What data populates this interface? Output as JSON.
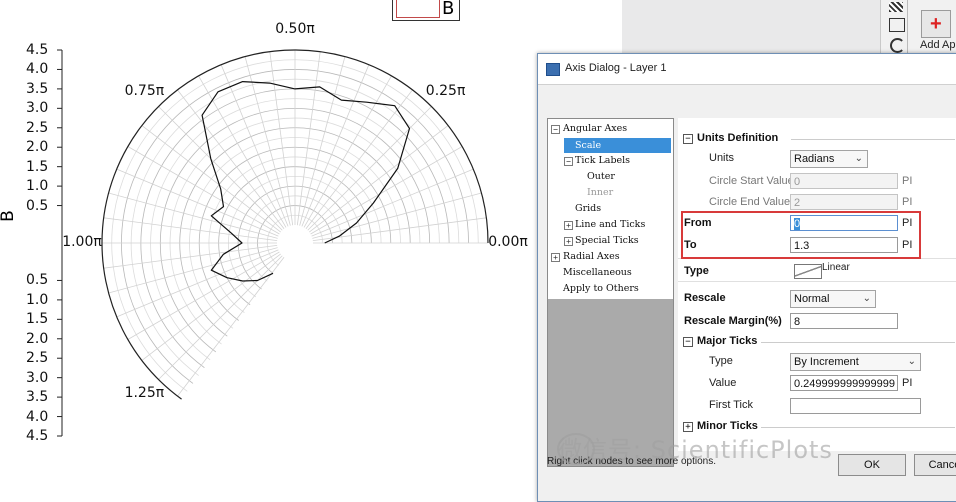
{
  "chart_data": {
    "type": "polar-line",
    "legend": [
      "B"
    ],
    "yaxis_label": "B",
    "radial_range": [
      0,
      4.5
    ],
    "radial_ticks": [
      "4.5",
      "4.0",
      "3.5",
      "3.0",
      "2.5",
      "2.0",
      "1.5",
      "1.0",
      "0.5",
      "0.5",
      "1.0",
      "1.5",
      "2.0",
      "2.5",
      "3.0",
      "3.5",
      "4.0",
      "4.5"
    ],
    "angular_range_pi": [
      0,
      1.3
    ],
    "angular_labels": [
      "0.00π",
      "0.25π",
      "0.50π",
      "0.75π",
      "1.00π",
      "1.25π"
    ],
    "angular_label_values_pi": [
      0,
      0.25,
      0.5,
      0.75,
      1.0,
      1.25
    ],
    "grid": true,
    "series": [
      {
        "name": "B",
        "theta_pi": [
          0.0,
          0.05,
          0.1,
          0.15,
          0.2,
          0.25,
          0.3,
          0.35,
          0.4,
          0.45,
          0.5,
          0.55,
          0.6,
          0.65,
          0.7,
          0.75,
          0.8,
          0.85,
          0.9,
          0.95,
          1.0,
          1.05,
          1.1,
          1.15,
          1.2,
          1.25,
          1.3
        ],
        "r": [
          0.3,
          0.7,
          1.2,
          1.8,
          2.8,
          3.7,
          3.9,
          3.6,
          3.4,
          3.6,
          3.5,
          3.7,
          3.9,
          3.9,
          3.6,
          2.6,
          1.9,
          1.6,
          1.8,
          1.2,
          0.9,
          1.4,
          1.8,
          1.5,
          1.2,
          0.9,
          0.5
        ]
      }
    ]
  },
  "app": {
    "add_app_label": "Add Ap"
  },
  "dialog": {
    "title": "Axis Dialog - Layer 1",
    "tree": {
      "items": [
        {
          "label": "Angular Axes",
          "expander": "−"
        },
        {
          "label": "Scale",
          "selected": true
        },
        {
          "label": "Tick Labels",
          "expander": "−"
        },
        {
          "label": "Outer"
        },
        {
          "label": "Inner",
          "disabled": true
        },
        {
          "label": "Grids"
        },
        {
          "label": "Line and Ticks",
          "expander": "+"
        },
        {
          "label": "Special Ticks",
          "expander": "+"
        },
        {
          "label": "Radial Axes",
          "expander": "+"
        },
        {
          "label": "Miscellaneous"
        },
        {
          "label": "Apply to Others"
        }
      ]
    },
    "units_section": "Units Definition",
    "units_label": "Units",
    "units_value": "Radians",
    "circle_start_label": "Circle Start Value",
    "circle_start_value": "0",
    "circle_end_label": "Circle End Value",
    "circle_end_value": "2",
    "pi_suffix": "PI",
    "from_label": "From",
    "from_value": "0",
    "to_label": "To",
    "to_value": "1.3",
    "type_label": "Type",
    "type_value": "Linear",
    "rescale_label": "Rescale",
    "rescale_value": "Normal",
    "rescale_margin_label": "Rescale Margin(%)",
    "rescale_margin_value": "8",
    "major_ticks_section": "Major Ticks",
    "mt_type_label": "Type",
    "mt_type_value": "By Increment",
    "mt_value_label": "Value",
    "mt_value_value": "0.249999999999999",
    "first_tick_label": "First Tick",
    "first_tick_value": "",
    "minor_ticks_section": "Minor Ticks",
    "status_text": "Right click nodes to see more options.",
    "ok_label": "OK",
    "cancel_label": "Cance"
  },
  "watermark": "微信号: ScientificPlots"
}
